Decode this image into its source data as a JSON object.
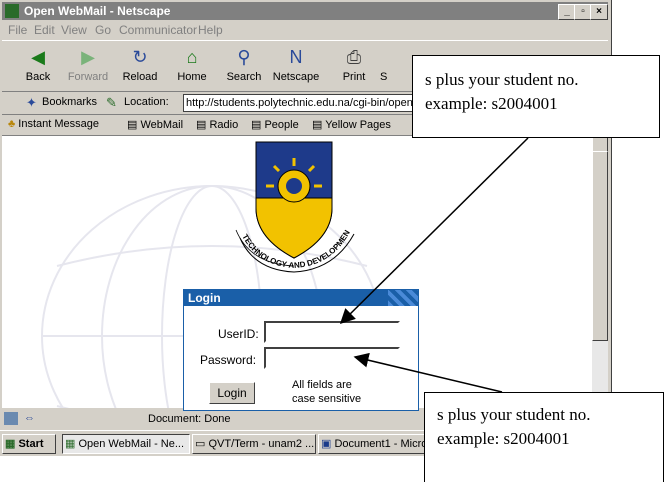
{
  "window": {
    "title": "Open WebMail - Netscape"
  },
  "menu": [
    "File",
    "Edit",
    "View",
    "Go",
    "Communicator",
    "Help"
  ],
  "nav": [
    {
      "label": "Back",
      "icon": "back-icon"
    },
    {
      "label": "Forward",
      "icon": "forward-icon"
    },
    {
      "label": "Reload",
      "icon": "reload-icon"
    },
    {
      "label": "Home",
      "icon": "home-icon"
    },
    {
      "label": "Search",
      "icon": "search-icon"
    },
    {
      "label": "Netscape",
      "icon": "netscape-icon"
    },
    {
      "label": "Print",
      "icon": "print-icon"
    },
    {
      "label": "S",
      "icon": "security-icon"
    }
  ],
  "location": {
    "bookmarks": "Bookmarks",
    "label": "Location:",
    "url": "http://students.polytechnic.edu.na/cgi-bin/openw"
  },
  "personal": [
    "Instant Message",
    "WebMail",
    "Radio",
    "People",
    "Yellow Pages"
  ],
  "logo": {
    "text": "TECHNOLOGY AND DEVELOPMENT"
  },
  "login": {
    "header": "Login",
    "userid_label": "UserID:",
    "password_label": "Password:",
    "button": "Login",
    "note_line1": "All fields are",
    "note_line2": "case sensitive"
  },
  "status": {
    "text": "Document: Done"
  },
  "taskbar": {
    "start": "Start",
    "tasks": [
      "Open WebMail - Ne...",
      "QVT/Term - unam2 ...",
      "Document1 - Micro"
    ]
  },
  "callouts": {
    "top": {
      "line1": "s plus your student no.",
      "line2": "example: s2004001"
    },
    "bottom": {
      "line1": "s plus your student no.",
      "line2": "example: s2004001"
    }
  },
  "colors": {
    "accent": "#1a5fa8",
    "shield_blue": "#1e3a8a",
    "shield_yellow": "#f2c200"
  }
}
